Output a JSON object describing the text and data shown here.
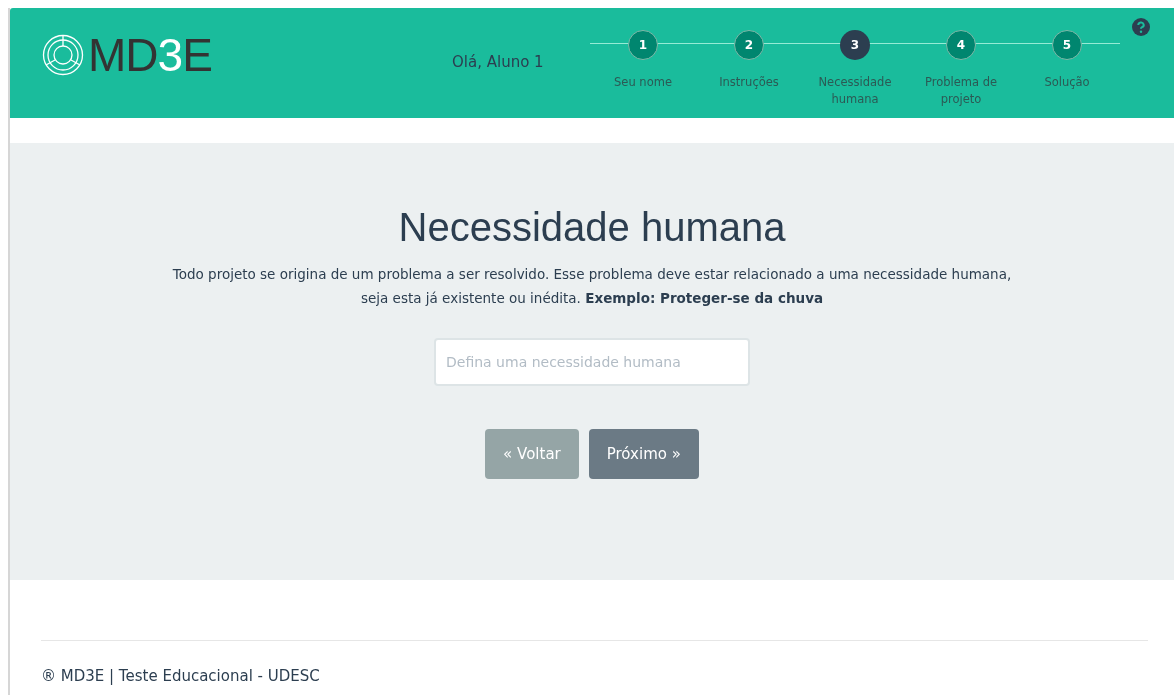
{
  "header": {
    "logo": [
      {
        "text": "MD",
        "accent": false
      },
      {
        "text": "3",
        "accent": true
      },
      {
        "text": "E",
        "accent": false
      }
    ],
    "greeting": "Olá, Aluno 1",
    "steps": [
      {
        "number": "1",
        "label": "Seu nome",
        "selected": false
      },
      {
        "number": "2",
        "label": "Instruções",
        "selected": false
      },
      {
        "number": "3",
        "label": "Necessidade humana",
        "selected": true
      },
      {
        "number": "4",
        "label": "Problema de projeto",
        "selected": false
      },
      {
        "number": "5",
        "label": "Solução",
        "selected": false
      }
    ]
  },
  "main": {
    "title": "Necessidade humana",
    "description": "Todo projeto se origina de um problema a ser resolvido. Esse problema deve estar relacionado a uma necessidade humana, seja esta já existente ou inédita. **Exemplo: Proteger-se da chuva**",
    "input": {
      "placeholder": "Defina uma necessidade humana"
    },
    "buttons": [
      {
        "label": "« Voltar",
        "kind": "secondary"
      },
      {
        "label": "Próximo »",
        "kind": "primary"
      }
    ]
  },
  "footer": "® MD3E | Teste Educacional - UDESC"
}
